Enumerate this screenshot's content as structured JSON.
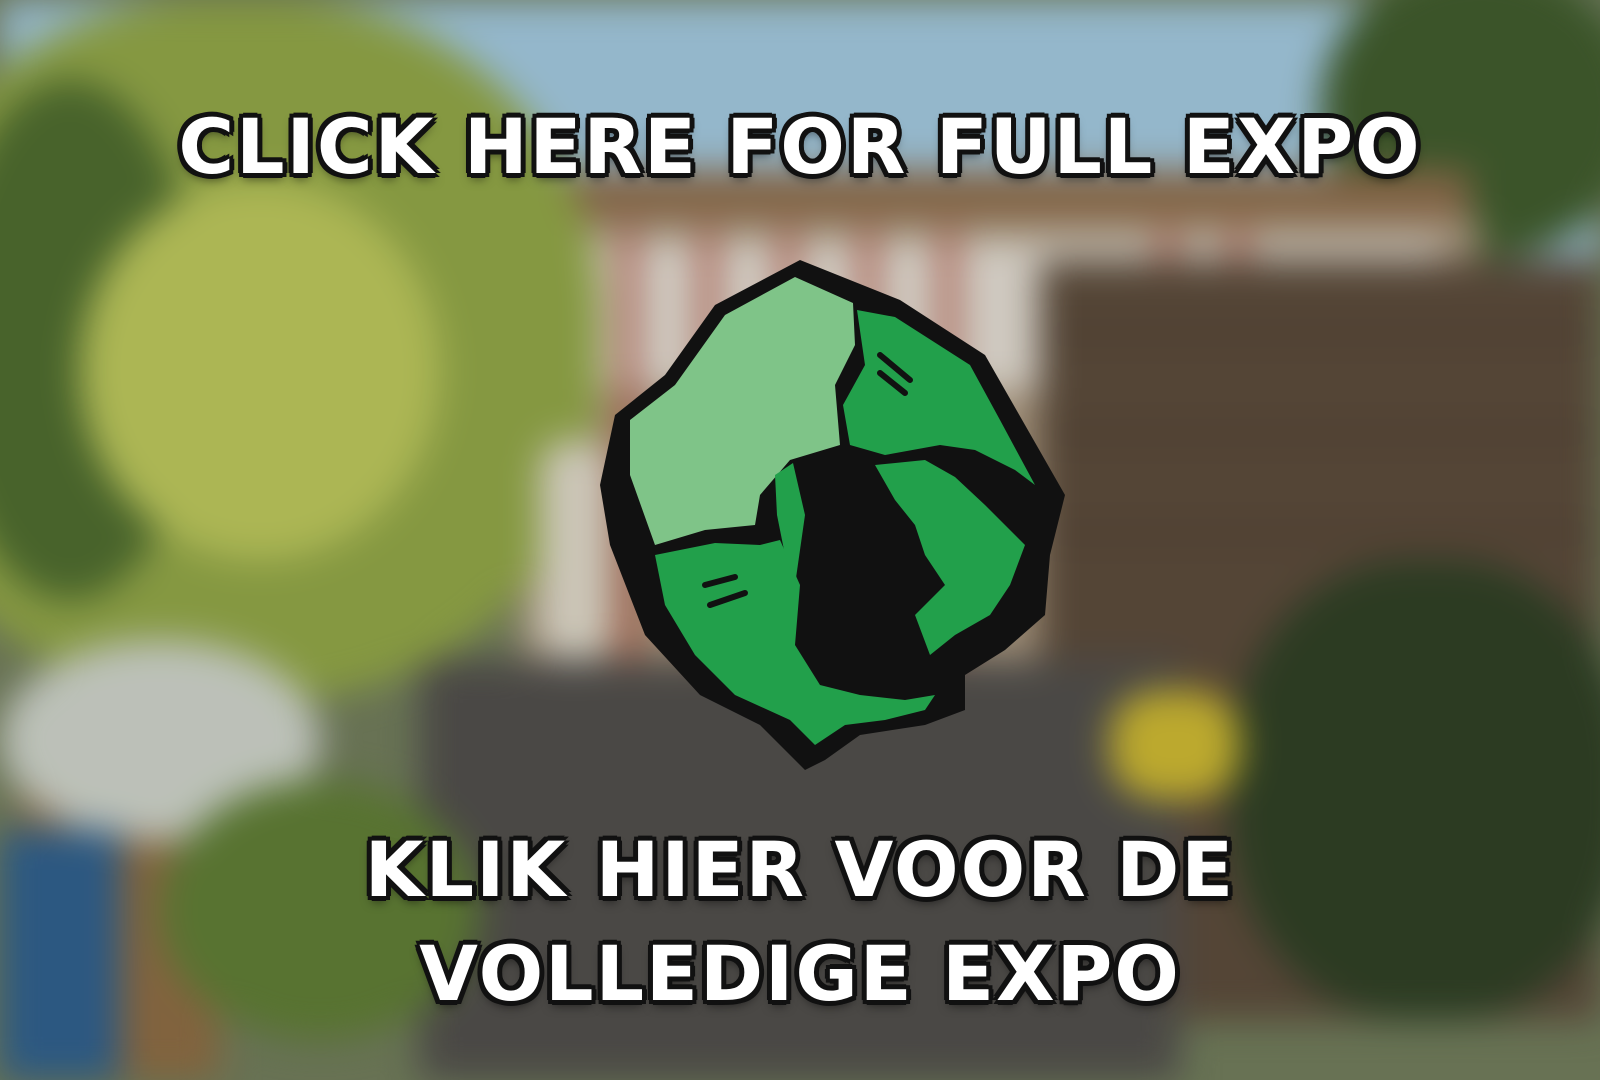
{
  "banner": {
    "title_en": "CLICK HERE FOR FULL EXPO",
    "title_nl_line1": "KLIK HIER VOOR DE",
    "title_nl_line2": "VOLLEDIGE EXPO"
  },
  "logo": {
    "icon": "green-rock-logo-icon",
    "colors": {
      "light_green": "#7fc488",
      "green": "#22a04b",
      "outline": "#111111"
    }
  }
}
